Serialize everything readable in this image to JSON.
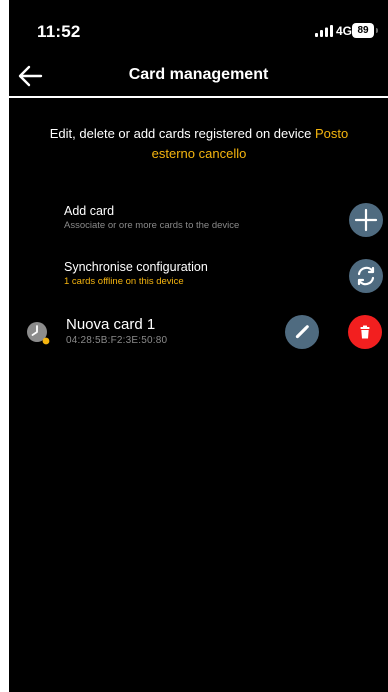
{
  "status_bar": {
    "time": "11:52",
    "network": "4G",
    "battery": "89"
  },
  "header": {
    "title": "Card management",
    "back_icon": "arrow-left-icon"
  },
  "description": {
    "text": "Edit, delete or add cards registered on device ",
    "device_name": "Posto esterno cancello"
  },
  "actions": {
    "add": {
      "title": "Add card",
      "subtitle": "Associate or ore more cards to the device",
      "icon": "plus-icon"
    },
    "sync": {
      "title": "Synchronise configuration",
      "subtitle": "1 cards offline on this device",
      "icon": "sync-icon"
    }
  },
  "cards": [
    {
      "name": "Nuova card 1",
      "mac": "04:28:5B:F2:3E:50:80",
      "status_icon": "clock-icon",
      "edit_icon": "pencil-icon",
      "delete_icon": "trash-icon"
    }
  ],
  "colors": {
    "background": "#000000",
    "accent": "#f5b50f",
    "button": "#4f6b80",
    "delete": "#f21f1f",
    "muted_text": "#8a8a8a"
  }
}
